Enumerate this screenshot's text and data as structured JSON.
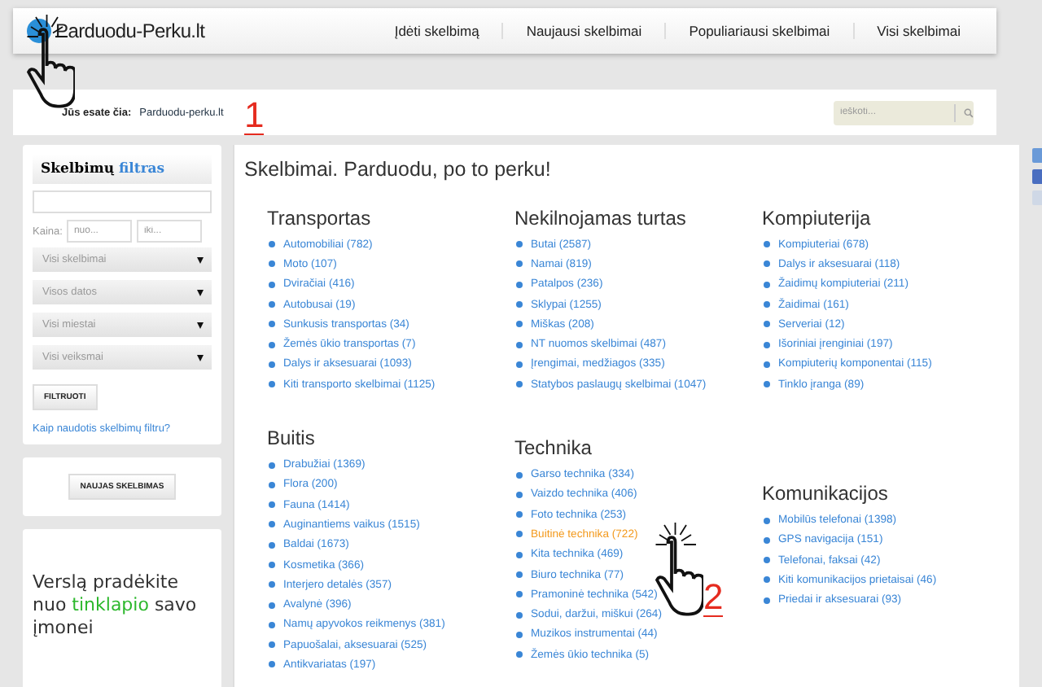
{
  "header": {
    "logo": "Parduodu-Perku.lt",
    "nav": [
      {
        "label": "Įdėti skelbimą"
      },
      {
        "label": "Naujausi skelbimai"
      },
      {
        "label": "Populiariausi skelbimai"
      },
      {
        "label": "Visi skelbimai"
      }
    ]
  },
  "breadcrumb": {
    "label": "Jūs esate čia:",
    "link": "Parduodu-perku.lt"
  },
  "search": {
    "placeholder": "ieškoti..."
  },
  "filter": {
    "title": "Skelbimų",
    "title_accent": "filtras",
    "price_label": "Kaina:",
    "price_from": {
      "placeholder": "nuo..."
    },
    "price_to": {
      "placeholder": "iki..."
    },
    "selects": [
      "Visi skelbimai",
      "Visos datos",
      "Visi miestai",
      "Visi veiksmai"
    ],
    "button": "FILTRUOTI",
    "help_link": "Kaip naudotis skelbimų filtru?"
  },
  "new_ad_button": "NAUJAS SKELBIMAS",
  "ad": {
    "before": "Verslą pradėkite nuo",
    "accent": "tinklapio",
    "after": "savo įmonei"
  },
  "main": {
    "title": "Skelbimai. Parduodu, po to perku!",
    "columns": [
      {
        "sections": [
          {
            "title": "Transportas",
            "items": [
              {
                "label": "Automobiliai (782)",
                "hovered": false
              },
              {
                "label": "Moto (107)",
                "hovered": false
              },
              {
                "label": "Dviračiai (416)",
                "hovered": false
              },
              {
                "label": "Autobusai (19)",
                "hovered": false
              },
              {
                "label": "Sunkusis transportas (34)",
                "hovered": false
              },
              {
                "label": "Žemės ūkio transportas (7)",
                "hovered": false
              },
              {
                "label": "Dalys ir aksesuarai (1093)",
                "hovered": false
              },
              {
                "label": "Kiti transporto skelbimai (1125)",
                "hovered": false
              }
            ]
          },
          {
            "title": "Buitis",
            "items": [
              {
                "label": "Drabužiai (1369)",
                "hovered": false
              },
              {
                "label": "Flora (200)",
                "hovered": false
              },
              {
                "label": "Fauna (1414)",
                "hovered": false
              },
              {
                "label": "Auginantiems vaikus (1515)",
                "hovered": false
              },
              {
                "label": "Baldai (1673)",
                "hovered": false
              },
              {
                "label": "Kosmetika (366)",
                "hovered": false
              },
              {
                "label": "Interjero detalės (357)",
                "hovered": false
              },
              {
                "label": "Avalynė (396)",
                "hovered": false
              },
              {
                "label": "Namų apyvokos reikmenys (381)",
                "hovered": false
              },
              {
                "label": "Papuošalai, aksesuarai (525)",
                "hovered": false
              },
              {
                "label": "Antikvariatas (197)",
                "hovered": false
              }
            ]
          }
        ]
      },
      {
        "sections": [
          {
            "title": "Nekilnojamas turtas",
            "items": [
              {
                "label": "Butai (2587)",
                "hovered": false
              },
              {
                "label": "Namai (819)",
                "hovered": false
              },
              {
                "label": "Patalpos (236)",
                "hovered": false
              },
              {
                "label": "Sklypai (1255)",
                "hovered": false
              },
              {
                "label": "Miškas (208)",
                "hovered": false
              },
              {
                "label": "NT nuomos skelbimai (487)",
                "hovered": false
              },
              {
                "label": "Įrengimai, medžiagos (335)",
                "hovered": false
              },
              {
                "label": "Statybos paslaugų skelbimai (1047)",
                "hovered": false
              }
            ]
          },
          {
            "title": "Technika",
            "items": [
              {
                "label": "Garso technika (334)",
                "hovered": false
              },
              {
                "label": "Vaizdo technika (406)",
                "hovered": false
              },
              {
                "label": "Foto technika (253)",
                "hovered": false
              },
              {
                "label": "Buitinė technika (722)",
                "hovered": true
              },
              {
                "label": "Kita technika (469)",
                "hovered": false
              },
              {
                "label": "Biuro technika (77)",
                "hovered": false
              },
              {
                "label": "Pramoninė technika (542)",
                "hovered": false
              },
              {
                "label": "Sodui, daržui, miškui (264)",
                "hovered": false
              },
              {
                "label": "Muzikos instrumentai (44)",
                "hovered": false
              },
              {
                "label": "Žemės ūkio technika (5)",
                "hovered": false
              }
            ]
          }
        ]
      },
      {
        "sections": [
          {
            "title": "Kompiuterija",
            "items": [
              {
                "label": "Kompiuteriai (678)",
                "hovered": false
              },
              {
                "label": "Dalys ir aksesuarai (118)",
                "hovered": false
              },
              {
                "label": "Žaidimų kompiuteriai (211)",
                "hovered": false
              },
              {
                "label": "Žaidimai (161)",
                "hovered": false
              },
              {
                "label": "Serveriai (12)",
                "hovered": false
              },
              {
                "label": "Išoriniai įrenginiai (197)",
                "hovered": false
              },
              {
                "label": "Kompiuterių komponentai (115)",
                "hovered": false
              },
              {
                "label": "Tinklo įranga (89)",
                "hovered": false
              }
            ]
          },
          {
            "title": "Komunikacijos",
            "items": [
              {
                "label": "Mobilūs telefonai (1398)",
                "hovered": false
              },
              {
                "label": "GPS navigacija (151)",
                "hovered": false
              },
              {
                "label": "Telefonai, faksai (42)",
                "hovered": false
              },
              {
                "label": "Kiti komunikacijos prietaisai (46)",
                "hovered": false
              },
              {
                "label": "Priedai ir aksesuarai (93)",
                "hovered": false
              }
            ]
          }
        ]
      }
    ]
  },
  "annotations": [
    {
      "number": "1"
    },
    {
      "number": "2"
    }
  ]
}
